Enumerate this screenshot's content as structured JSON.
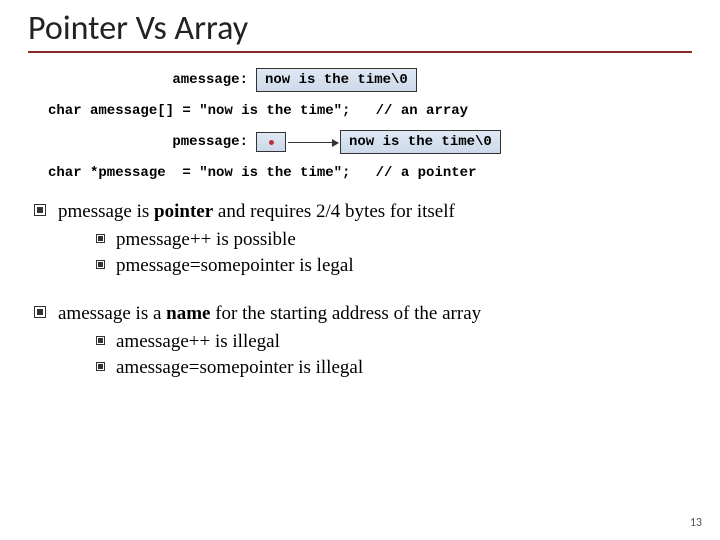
{
  "title": "Pointer Vs Array",
  "diagram": {
    "amessage_label": "amessage:",
    "amessage_box": "now is the time\\0",
    "pmessage_label": "pmessage:",
    "pmessage_box": "now is the time\\0"
  },
  "code": {
    "array_decl": "char amessage[] = \"now is the time\";   // an array",
    "pointer_decl": "char *pmessage  = \"now is the time\";   // a pointer"
  },
  "bullets": {
    "b1_pre": "pmessage is ",
    "b1_bold": "pointer",
    "b1_post": " and requires 2/4 bytes for itself",
    "b1_sub1": "pmessage++ is possible",
    "b1_sub2": "pmessage=somepointer is legal",
    "b2_pre": "amessage is a ",
    "b2_bold": "name",
    "b2_post": " for the starting address of the array",
    "b2_sub1": "amessage++ is illegal",
    "b2_sub2": "amessage=somepointer is illegal"
  },
  "page_number": "13"
}
